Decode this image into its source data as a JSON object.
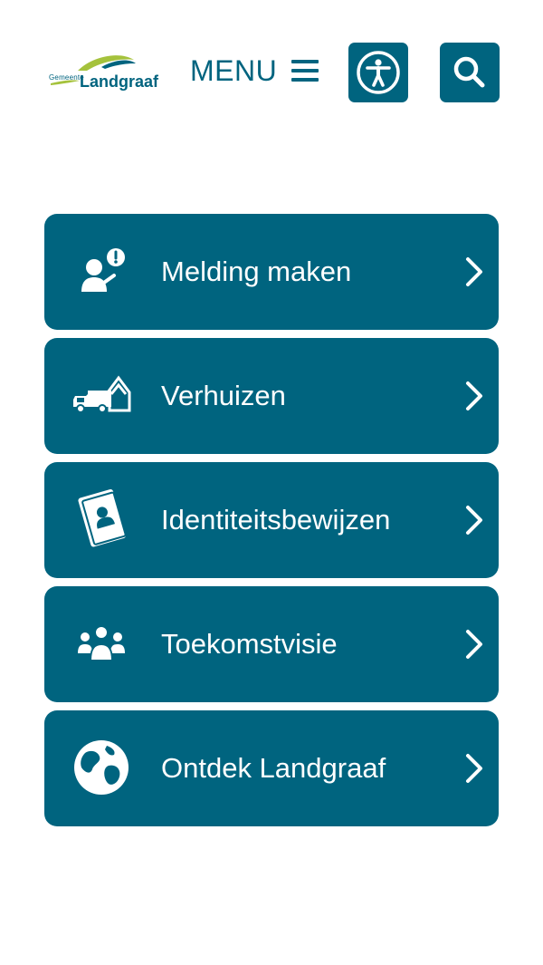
{
  "header": {
    "logo": {
      "prefix": "Gemeente",
      "name": "Landgraaf"
    },
    "menu_label": "MENU",
    "accessibility_icon": "accessibility-icon",
    "search_icon": "search-icon"
  },
  "tiles": [
    {
      "label": "Melding maken",
      "icon": "report-person-icon"
    },
    {
      "label": "Verhuizen",
      "icon": "moving-truck-icon"
    },
    {
      "label": "Identiteitsbewijzen",
      "icon": "id-document-icon"
    },
    {
      "label": "Toekomstvisie",
      "icon": "group-icon"
    },
    {
      "label": "Ontdek Landgraaf",
      "icon": "globe-icon"
    }
  ],
  "colors": {
    "primary": "#00647f",
    "logo_green": "#a5c23c",
    "background": "#ffffff",
    "text_on_primary": "#ffffff"
  }
}
